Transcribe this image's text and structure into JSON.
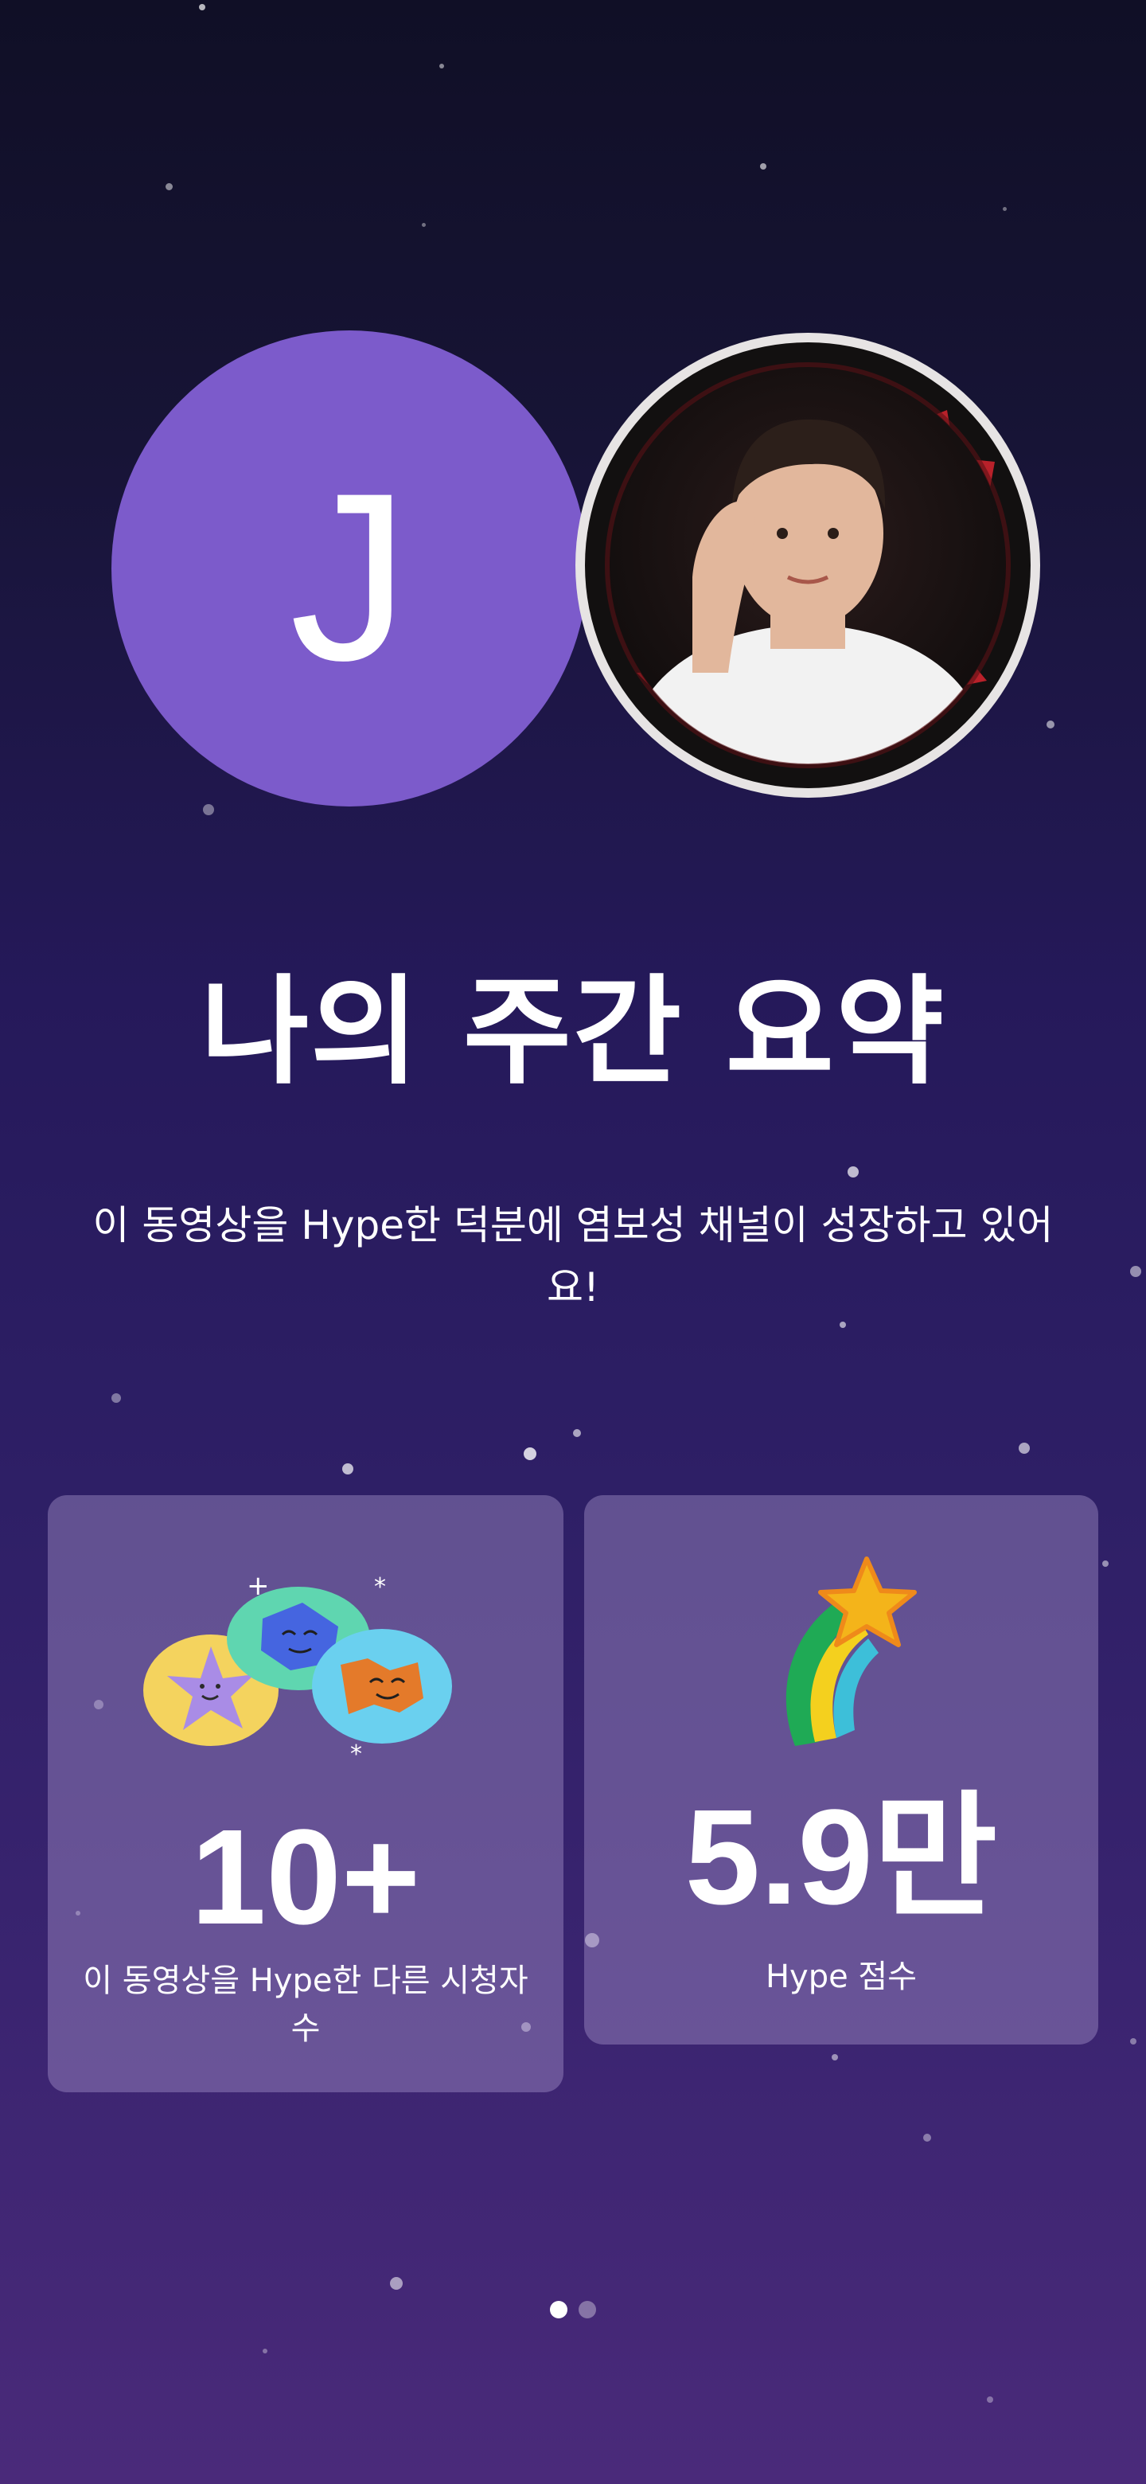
{
  "avatar": {
    "initial": "J",
    "color": "#7c5bcb"
  },
  "title": "나의 주간 요약",
  "subtitle": "이 동영상을 Hype한 덕분에 염보성 채널이 성장하고 있어요!",
  "stats": [
    {
      "value": "10+",
      "label": "이 동영상을 Hype한 다른 시청자 수",
      "icon": "happy-faces-icon"
    },
    {
      "value": "5.9만",
      "label": "Hype 점수",
      "icon": "shooting-star-icon"
    }
  ],
  "pager": {
    "total": 2,
    "current": 1
  }
}
